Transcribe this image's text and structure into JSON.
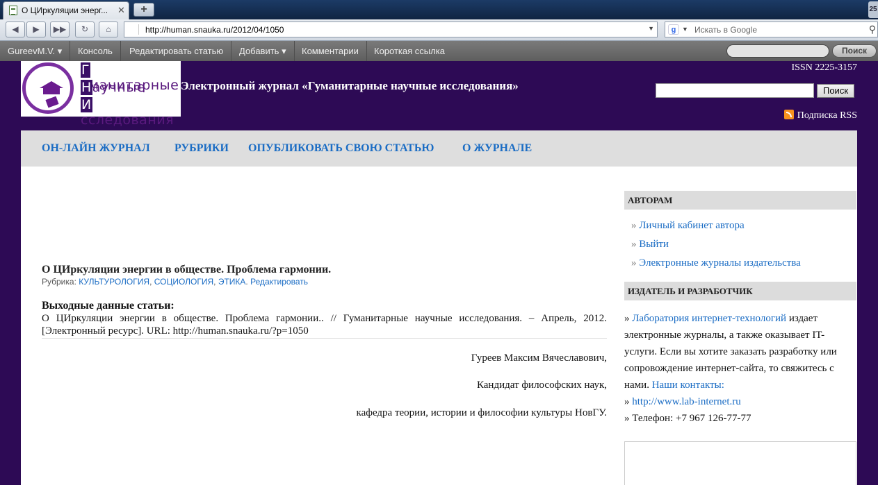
{
  "browser": {
    "tab_title": "О ЦИркуляции энерг...",
    "tab_close": "✕",
    "new_tab": "+",
    "right_badge": "25",
    "url": "http://human.snauka.ru/2012/04/1050",
    "search_placeholder": "Искать в Google",
    "search_engine_letter": "g"
  },
  "adminbar": {
    "items": [
      "GureevM.V. ▾",
      "Консоль",
      "Редактировать статью",
      "Добавить ▾",
      "Комментарии",
      "Короткая ссылка"
    ],
    "search_button": "Поиск"
  },
  "header": {
    "logo_lines": [
      {
        "first": "Г",
        "rest": "уманитарные"
      },
      {
        "first": "Н",
        "rest": "аучные"
      },
      {
        "first": "И",
        "rest": "сследования"
      }
    ],
    "site_title": "Электронный журнал «Гуманитарные научные исследования»",
    "issn": "ISSN 2225-3157",
    "search_button": "Поиск",
    "rss": "Подписка RSS"
  },
  "menu": [
    "ОН-ЛАЙН ЖУРНАЛ",
    "РУБРИКИ",
    "ОПУБЛИКОВАТЬ СВОЮ СТАТЬЮ",
    "О ЖУРНАЛЕ"
  ],
  "post": {
    "title": "О ЦИркуляции энергии в обществе. Проблема гармонии.",
    "meta_label": "Рубрика:",
    "categories": [
      "КУЛЬТУРОЛОГИЯ",
      "СОЦИОЛОГИЯ",
      "ЭТИКА"
    ],
    "edit": "Редактировать",
    "output_heading": "Выходные данные статьи:",
    "output_text": "О ЦИркуляции энергии в обществе. Проблема гармонии.. // Гуманитарные научные исследования. – Апрель, 2012. [Электронный ресурс]. URL: http://human.snauka.ru/?p=1050",
    "author_lines": [
      "Гуреев Максим Вячеславович,",
      "Кандидат философских наук,",
      "кафедра теории, истории и философии культуры НовГУ."
    ]
  },
  "sidebar": {
    "authors_heading": "АВТОРАМ",
    "authors_links": [
      "Личный кабинет автора",
      "Выйти",
      "Электронные журналы издательства"
    ],
    "publisher_heading": "ИЗДАТЕЛЬ И РАЗРАБОТЧИК",
    "publisher_link": "Лаборатория интернет-технологий",
    "publisher_text": "издает электронные журналы, а также оказывает IT-услуги. Если вы хотите заказать разработку или сопровождение интернет-сайта, то свяжитесь с нами.",
    "contacts_link": "Наши контакты:",
    "site_link": "http://www.lab-internet.ru",
    "phone": "Телефон: +7 967 126-77-77"
  }
}
